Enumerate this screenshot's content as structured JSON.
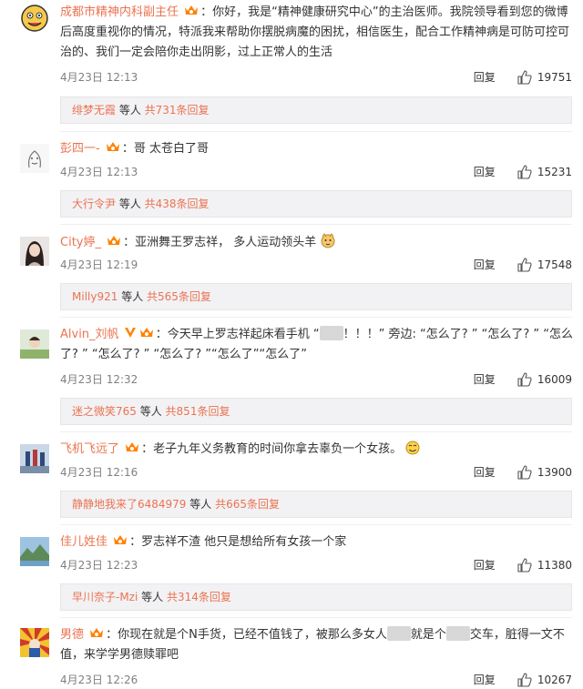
{
  "comments": [
    {
      "user": "成都市精神内科副主任",
      "colon": "：",
      "text": "你好，我是“精神健康研究中心”的主治医师。我院领导看到您的微博后高度重视你的情况，特派我来帮助你摆脱病魔的困扰，相信医生，配合工作精神病是可防可控可治的、我们一定会陪你走出阴影，过上正常人的生活",
      "time": "4月23日 12:13",
      "reply_label": "回复",
      "likes": "19751",
      "sub_user": "绯梦无霞",
      "sub_mid": " 等人 ",
      "sub_count": "共731条回复"
    },
    {
      "user": "彭四一-",
      "colon": "：",
      "text": "哥 太苍白了哥",
      "time": "4月23日 12:13",
      "reply_label": "回复",
      "likes": "15231",
      "sub_user": "大行令尹",
      "sub_mid": " 等人 ",
      "sub_count": "共438条回复"
    },
    {
      "user": "City婷_",
      "colon": "：",
      "text": "亚洲舞王罗志祥， 多人运动领头羊",
      "time": "4月23日 12:19",
      "reply_label": "回复",
      "likes": "17548",
      "sub_user": "Milly921",
      "sub_mid": " 等人 ",
      "sub_count": "共565条回复"
    },
    {
      "user": "Alvin_刘帆",
      "colon": "：",
      "text_a": "今天早上罗志祥起床看手机 “",
      "text_b": "！！！” 旁边: “怎么了? ” “怎么了? ” “怎么了? ” “怎么了? ” “怎么了? ”“怎么了”“怎么了”",
      "time": "4月23日 12:32",
      "reply_label": "回复",
      "likes": "16009",
      "sub_user": "迷之微笑765",
      "sub_mid": " 等人 ",
      "sub_count": "共851条回复"
    },
    {
      "user": "飞机飞远了",
      "colon": "：",
      "text": "老子九年义务教育的时间你拿去辜负一个女孩。",
      "time": "4月23日 12:16",
      "reply_label": "回复",
      "likes": "13900",
      "sub_user": "静静地我来了6484979",
      "sub_mid": " 等人 ",
      "sub_count": "共665条回复"
    },
    {
      "user": "佳儿姓佳",
      "colon": "：",
      "text": "罗志祥不渣 他只是想给所有女孩一个家",
      "time": "4月23日 12:23",
      "reply_label": "回复",
      "likes": "11380",
      "sub_user": "早川奈子-Mzi",
      "sub_mid": " 等人 ",
      "sub_count": "共314条回复"
    },
    {
      "user": "男德",
      "colon": "：",
      "text_a": "你现在就是个N手货，已经不值钱了，被那么多女人",
      "text_b": "就是个",
      "text_c": "交车，脏得一文不值，来学学男德赎罪吧",
      "time": "4月23日 12:26",
      "reply_label": "回复",
      "likes": "10267"
    }
  ],
  "colors": {
    "username": "#eb7350",
    "time": "#808080",
    "sub_bg": "#f2f2f5",
    "badge": "#ff8200"
  },
  "icons": {
    "vip_badge": "crown-badge-icon",
    "verified": "verified-v-icon",
    "like": "thumbs-up-icon",
    "emoji_dog": "dog-face-emoji",
    "emoji_smile": "smile-face-emoji"
  }
}
